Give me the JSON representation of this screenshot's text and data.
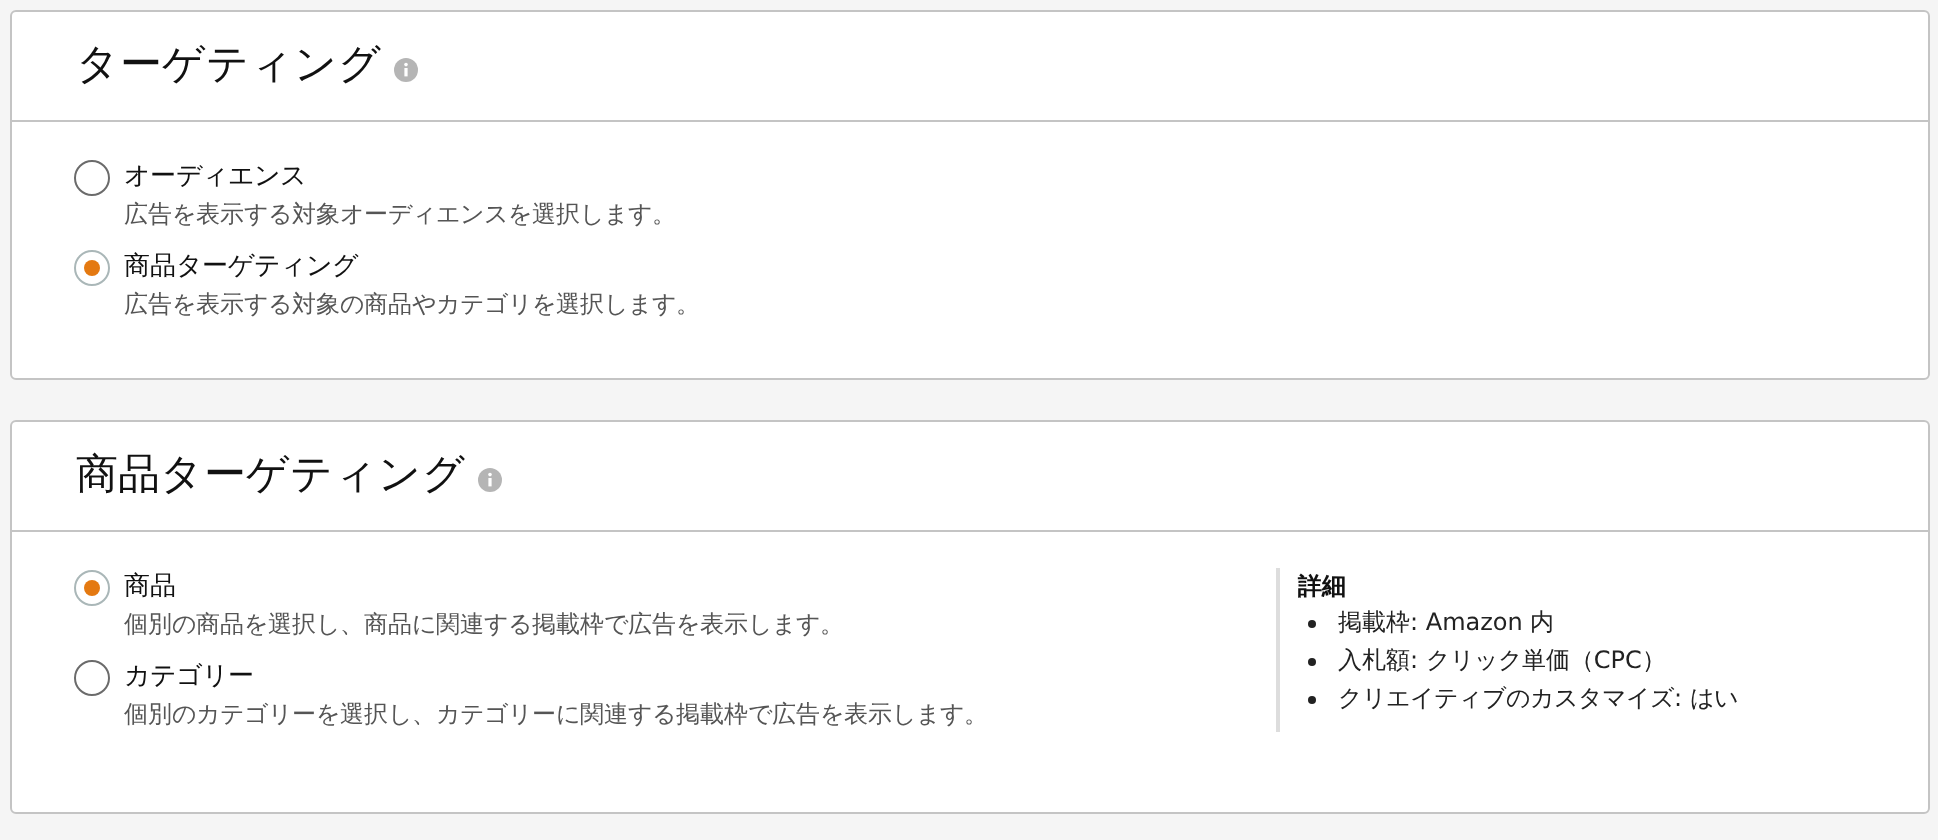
{
  "sections": [
    {
      "title": "ターゲティング",
      "options": [
        {
          "label": "オーディエンス",
          "description": "広告を表示する対象オーディエンスを選択します。",
          "selected": false
        },
        {
          "label": "商品ターゲティング",
          "description": "広告を表示する対象の商品やカテゴリを選択します。",
          "selected": true
        }
      ]
    },
    {
      "title": "商品ターゲティング",
      "options": [
        {
          "label": "商品",
          "description": "個別の商品を選択し、商品に関連する掲載枠で広告を表示します。",
          "selected": true
        },
        {
          "label": "カテゴリー",
          "description": "個別のカテゴリーを選択し、カテゴリーに関連する掲載枠で広告を表示します。",
          "selected": false
        }
      ],
      "details": {
        "heading": "詳細",
        "items": [
          "掲載枠: Amazon 内",
          "入札額: クリック単価（CPC）",
          "クリエイティブのカスタマイズ: はい"
        ]
      }
    }
  ]
}
